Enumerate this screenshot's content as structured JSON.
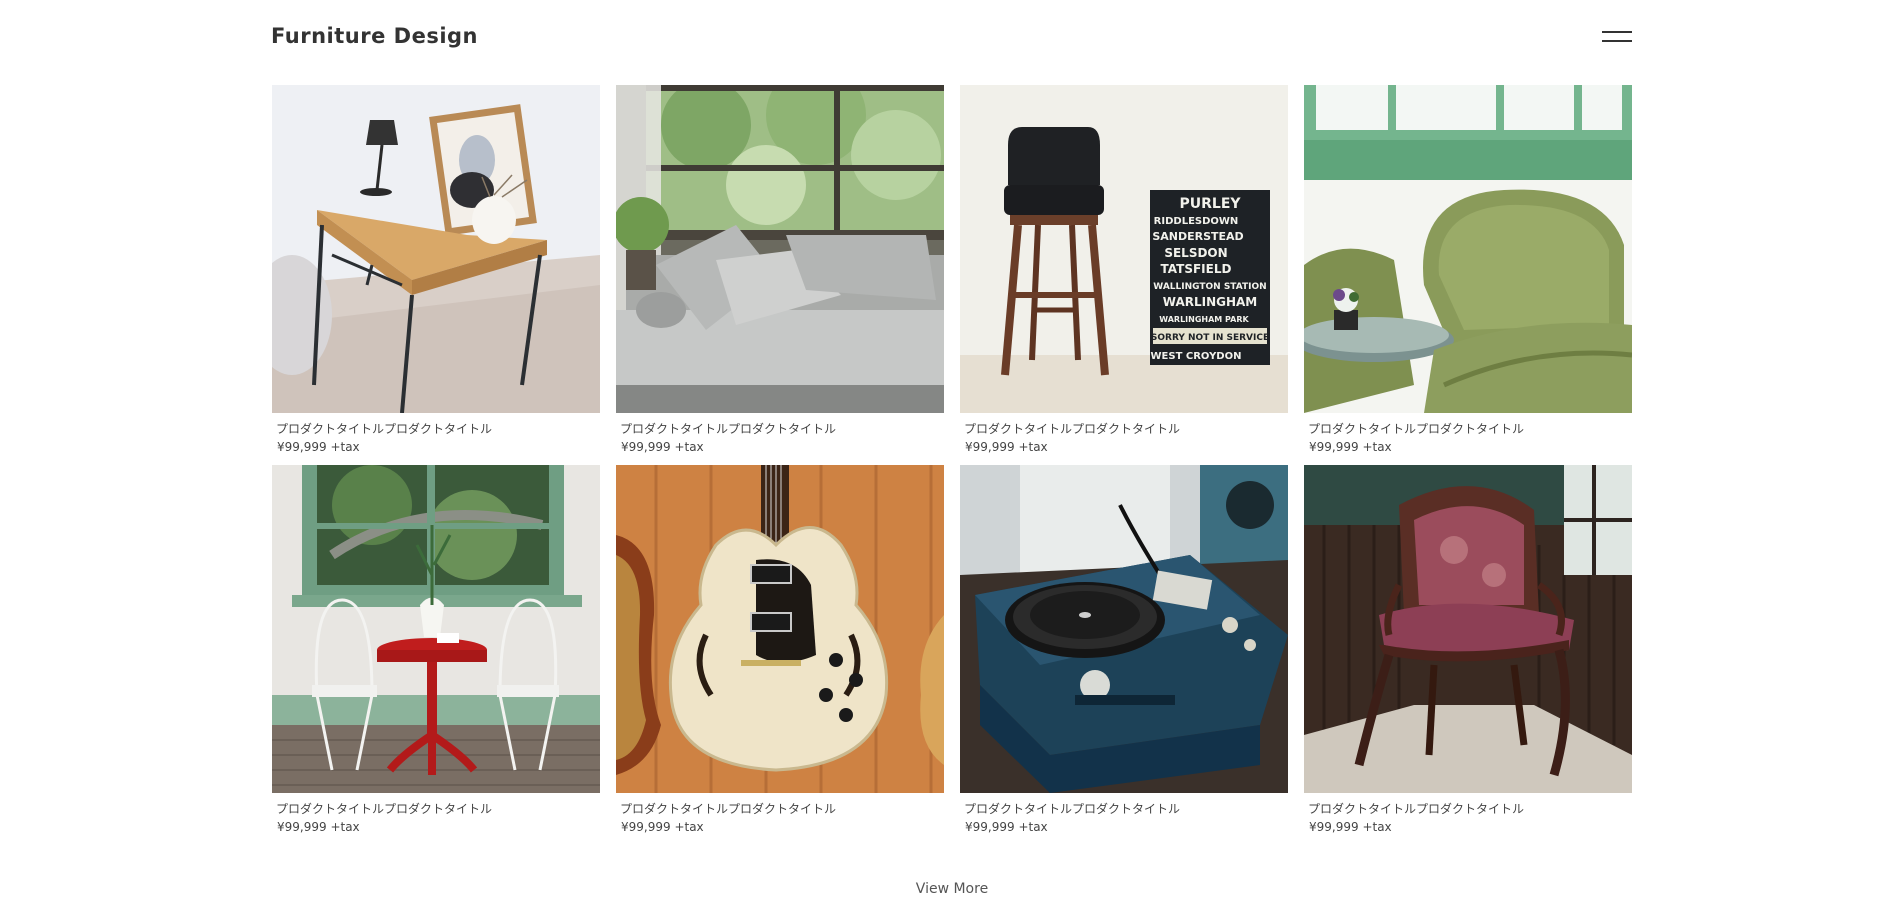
{
  "header": {
    "logo": "Furniture Design",
    "menu_icon": "hamburger-menu-icon"
  },
  "products": [
    {
      "title": "プロダクトタイトルプロダクトタイトル",
      "price": "¥99,999 +tax",
      "image": "desk-lamp-photo"
    },
    {
      "title": "プロダクトタイトルプロダクトタイトル",
      "price": "¥99,999 +tax",
      "image": "window-sofa-photo"
    },
    {
      "title": "プロダクトタイトルプロダクトタイトル",
      "price": "¥99,999 +tax",
      "image": "bar-stool-sign-photo",
      "sign": [
        "PURLEY",
        "RIDDLESDOWN",
        "SANDERSTEAD",
        "SELSDON",
        "TATSFIELD",
        "WALLINGTON STATION",
        "WARLINGHAM",
        "WARLINGHAM PARK",
        "SORRY NOT IN SERVICE",
        "WEST CROYDON"
      ]
    },
    {
      "title": "プロダクトタイトルプロダクトタイトル",
      "price": "¥99,999 +tax",
      "image": "wicker-chair-photo"
    },
    {
      "title": "プロダクトタイトルプロダクトタイトル",
      "price": "¥99,999 +tax",
      "image": "cafe-table-photo"
    },
    {
      "title": "プロダクトタイトルプロダクトタイトル",
      "price": "¥99,999 +tax",
      "image": "guitar-photo"
    },
    {
      "title": "プロダクトタイトルプロダクトタイトル",
      "price": "¥99,999 +tax",
      "image": "record-player-photo"
    },
    {
      "title": "プロダクトタイトルプロダクトタイトル",
      "price": "¥99,999 +tax",
      "image": "antique-chair-photo"
    }
  ],
  "view_more": "View More"
}
